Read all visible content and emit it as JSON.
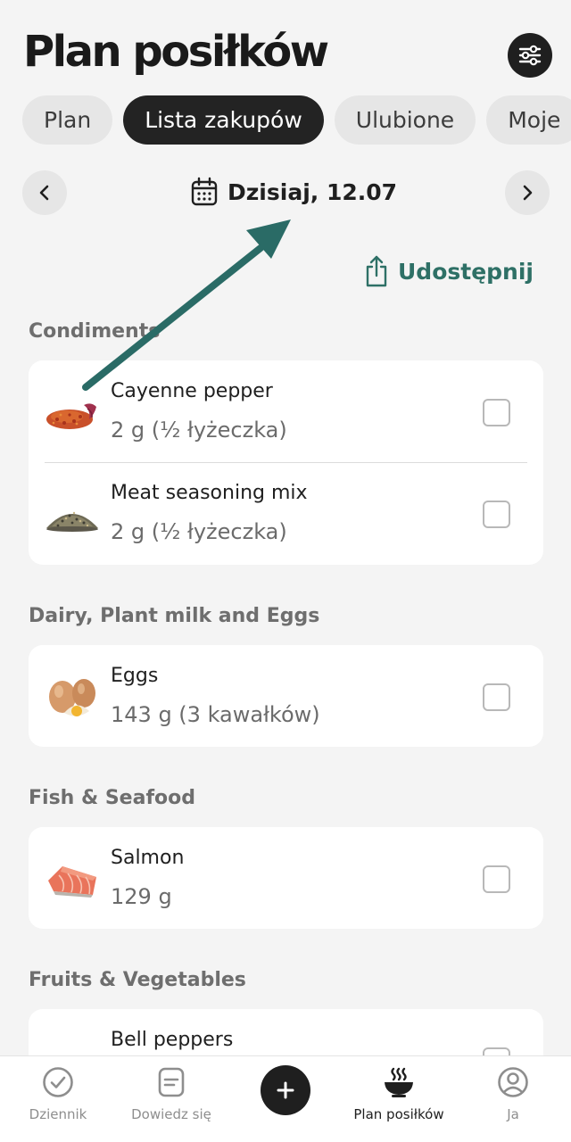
{
  "header": {
    "title": "Plan posiłków",
    "filter_icon": "sliders-icon"
  },
  "tabs": [
    {
      "label": "Plan",
      "active": false
    },
    {
      "label": "Lista zakupów",
      "active": true
    },
    {
      "label": "Ulubione",
      "active": false
    },
    {
      "label": "Moje",
      "active": false
    }
  ],
  "date_nav": {
    "date_label": "Dzisiaj, 12.07",
    "prev_icon": "chevron-left-icon",
    "next_icon": "chevron-right-icon",
    "calendar_icon": "calendar-icon"
  },
  "share": {
    "label": "Udostępnij",
    "icon": "share-icon",
    "color": "#2e7066"
  },
  "sections": [
    {
      "title": "Condiments",
      "items": [
        {
          "name": "Cayenne pepper",
          "quantity": "2 g (½ łyżeczka)",
          "checked": false,
          "image": "cayenne-pepper"
        },
        {
          "name": "Meat seasoning mix",
          "quantity": "2 g (½ łyżeczka)",
          "checked": false,
          "image": "seasoning-mix"
        }
      ]
    },
    {
      "title": "Dairy, Plant milk and Eggs",
      "items": [
        {
          "name": "Eggs",
          "quantity": "143 g (3 kawałków)",
          "checked": false,
          "image": "eggs"
        }
      ]
    },
    {
      "title": "Fish & Seafood",
      "items": [
        {
          "name": "Salmon",
          "quantity": "129 g",
          "checked": false,
          "image": "salmon"
        }
      ]
    },
    {
      "title": "Fruits & Vegetables",
      "items": [
        {
          "name": "Bell peppers",
          "quantity": "",
          "checked": false,
          "image": "bell-peppers"
        }
      ]
    }
  ],
  "annotation": {
    "type": "arrow",
    "color": "#2a6b66"
  },
  "bottom_nav": {
    "items": [
      {
        "label": "Dziennik",
        "icon": "check-circle-icon",
        "active": false
      },
      {
        "label": "Dowiedz się",
        "icon": "article-icon",
        "active": false
      },
      {
        "label": "Plan posiłków",
        "icon": "steaming-bowl-icon",
        "active": true
      },
      {
        "label": "Ja",
        "icon": "user-circle-icon",
        "active": false
      }
    ],
    "add_icon": "plus-icon"
  },
  "colors": {
    "background": "#f4f4f4",
    "card": "#ffffff",
    "accent_dark": "#1f1f1f",
    "accent_teal": "#2e7066"
  }
}
